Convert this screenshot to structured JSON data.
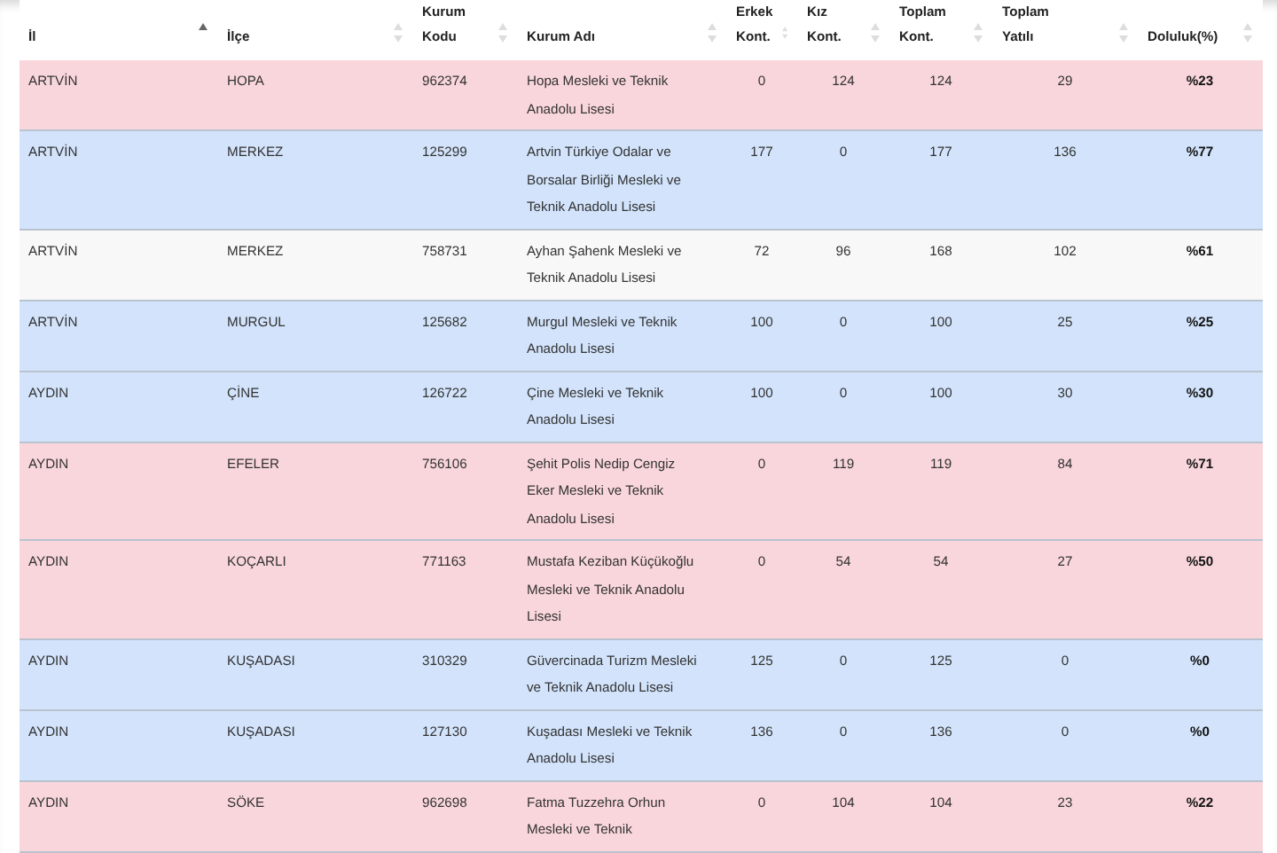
{
  "table": {
    "columns": [
      {
        "label": "İl",
        "sorted": true
      },
      {
        "label": "İlçe",
        "sorted": false
      },
      {
        "label": "Kurum Kodu",
        "sorted": false
      },
      {
        "label": "Kurum Adı",
        "sorted": false
      },
      {
        "label": "Erkek Kont.",
        "sorted": false
      },
      {
        "label": "Kız Kont.",
        "sorted": false
      },
      {
        "label": "Toplam Kont.",
        "sorted": false
      },
      {
        "label": "Toplam Yatılı",
        "sorted": false
      },
      {
        "label": "Doluluk(%)",
        "sorted": false
      }
    ],
    "rows": [
      {
        "color": "#f9d6dc",
        "cells": [
          "ARTVİN",
          "HOPA",
          "962374",
          "Hopa Mesleki ve Teknik Anadolu Lisesi",
          "0",
          "124",
          "124",
          "29",
          "%23"
        ]
      },
      {
        "color": "#d2e3fb",
        "cells": [
          "ARTVİN",
          "MERKEZ",
          "125299",
          "Artvin Türkiye Odalar ve Borsalar Birliği Mesleki ve Teknik Anadolu Lisesi",
          "177",
          "0",
          "177",
          "136",
          "%77"
        ]
      },
      {
        "color": "#f8f8f8",
        "cells": [
          "ARTVİN",
          "MERKEZ",
          "758731",
          "Ayhan Şahenk Mesleki ve Teknik Anadolu Lisesi",
          "72",
          "96",
          "168",
          "102",
          "%61"
        ]
      },
      {
        "color": "#d2e3fb",
        "cells": [
          "ARTVİN",
          "MURGUL",
          "125682",
          "Murgul Mesleki ve Teknik Anadolu Lisesi",
          "100",
          "0",
          "100",
          "25",
          "%25"
        ]
      },
      {
        "color": "#d2e3fb",
        "cells": [
          "AYDIN",
          "ÇİNE",
          "126722",
          "Çine Mesleki ve Teknik Anadolu Lisesi",
          "100",
          "0",
          "100",
          "30",
          "%30"
        ]
      },
      {
        "color": "#f9d6dc",
        "cells": [
          "AYDIN",
          "EFELER",
          "756106",
          "Şehit Polis Nedip Cengiz Eker Mesleki ve Teknik Anadolu Lisesi",
          "0",
          "119",
          "119",
          "84",
          "%71"
        ]
      },
      {
        "color": "#f9d6dc",
        "cells": [
          "AYDIN",
          "KOÇARLI",
          "771163",
          "Mustafa Keziban Küçükoğlu Mesleki ve Teknik Anadolu Lisesi",
          "0",
          "54",
          "54",
          "27",
          "%50"
        ]
      },
      {
        "color": "#d2e3fb",
        "cells": [
          "AYDIN",
          "KUŞADASI",
          "310329",
          "Güvercinada Turizm Mesleki ve Teknik Anadolu Lisesi",
          "125",
          "0",
          "125",
          "0",
          "%0"
        ]
      },
      {
        "color": "#d2e3fb",
        "cells": [
          "AYDIN",
          "KUŞADASI",
          "127130",
          "Kuşadası Mesleki ve Teknik Anadolu Lisesi",
          "136",
          "0",
          "136",
          "0",
          "%0"
        ]
      },
      {
        "color": "#f9d6dc",
        "cells": [
          "AYDIN",
          "SÖKE",
          "962698",
          "Fatma Tuzzehra Orhun Mesleki ve Teknik",
          "0",
          "104",
          "104",
          "23",
          "%22"
        ]
      }
    ]
  }
}
